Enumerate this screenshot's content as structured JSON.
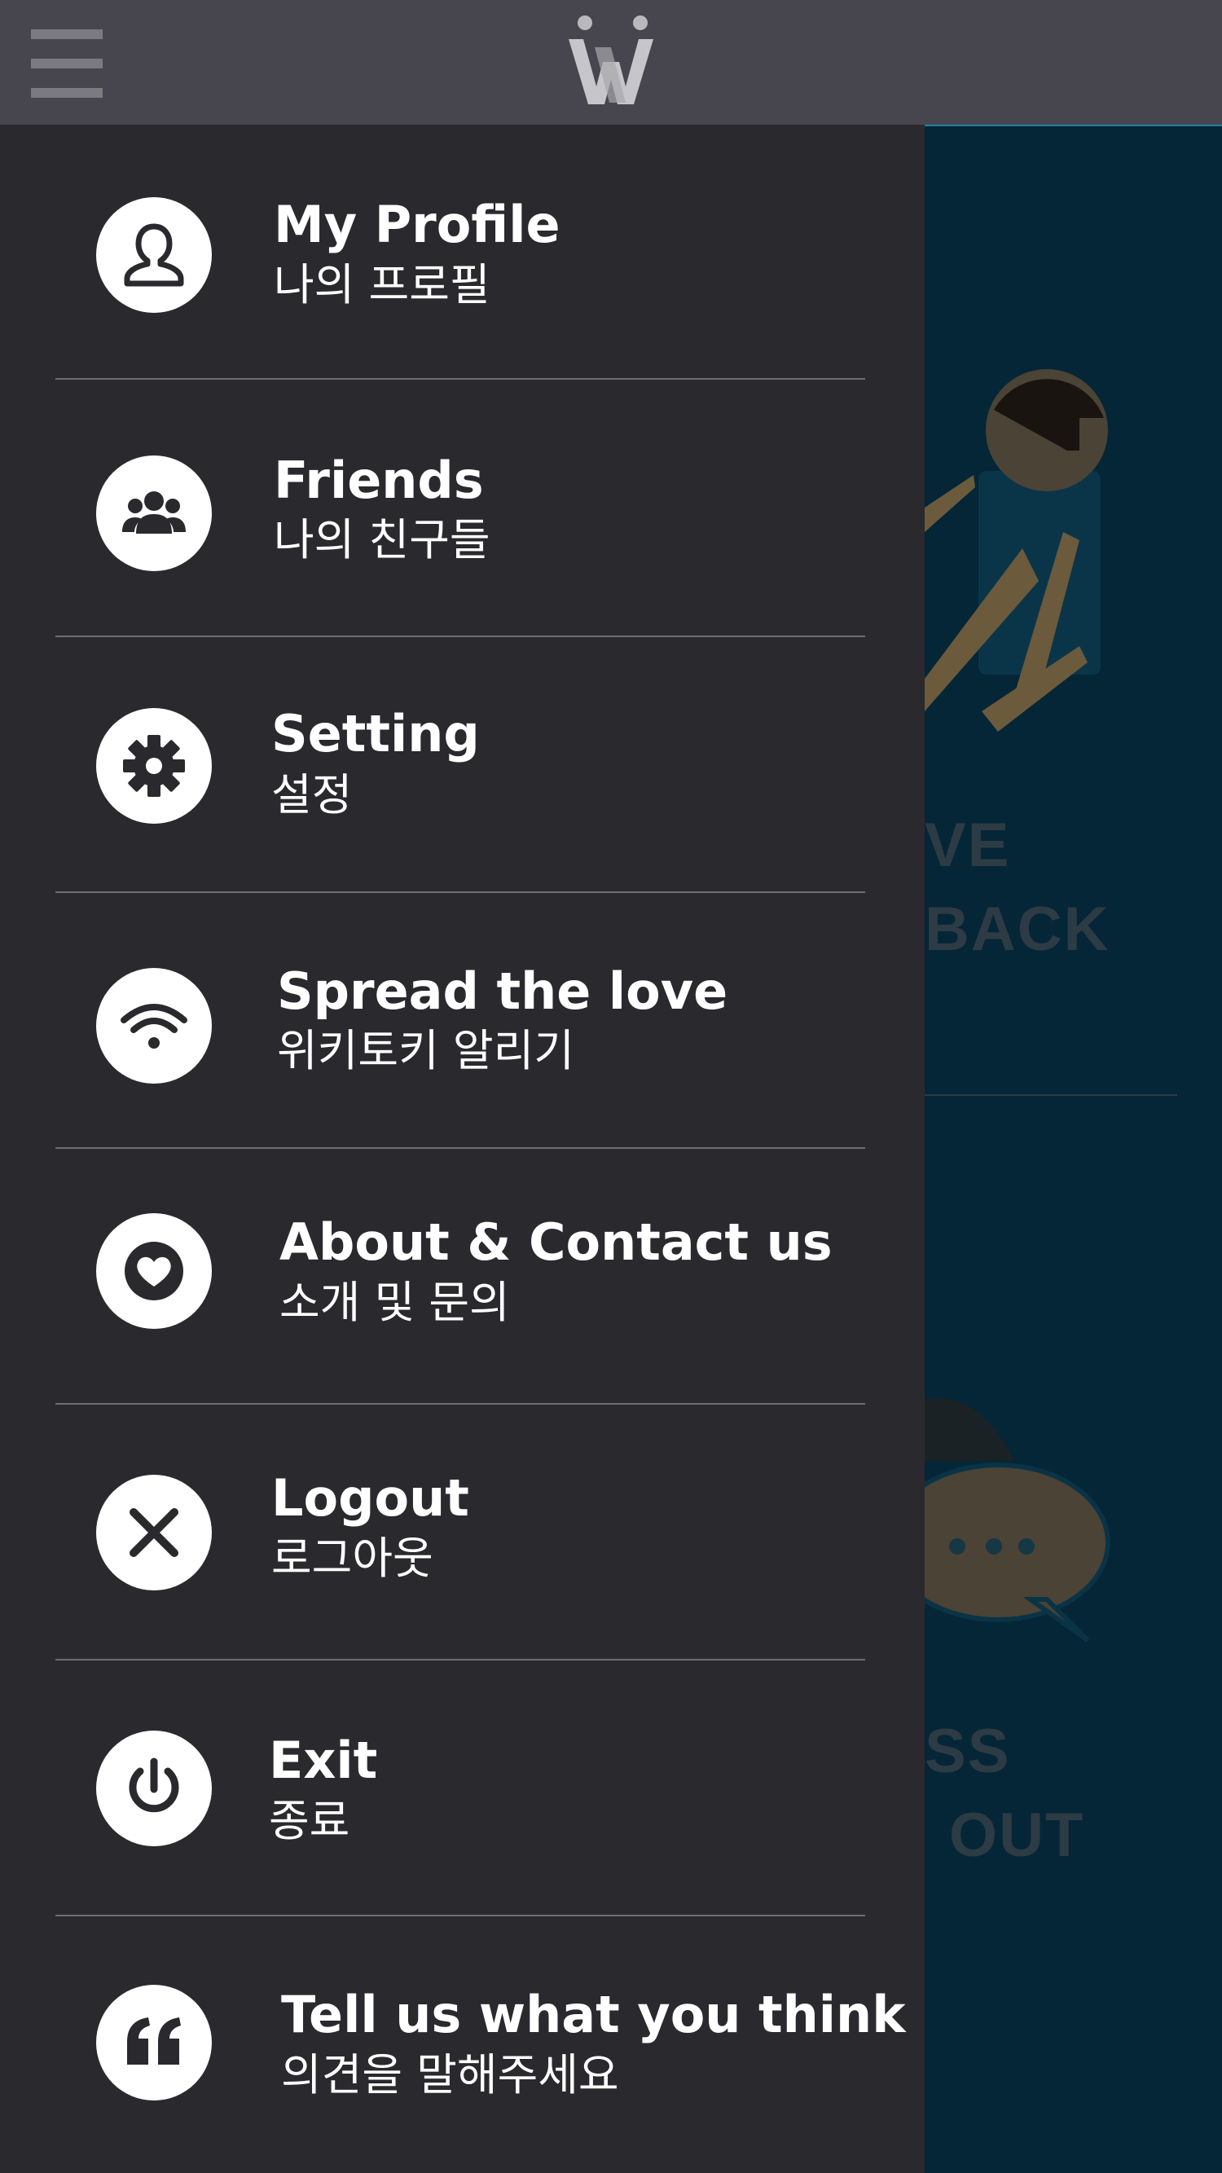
{
  "header": {
    "menu_icon": "hamburger-icon",
    "logo_icon": "wikitalki-logo"
  },
  "menu": {
    "items": [
      {
        "title": "My Profile",
        "subtitle": "나의 프로필",
        "icon": "profile-icon"
      },
      {
        "title": "Friends",
        "subtitle": "나의 친구들",
        "icon": "friends-icon"
      },
      {
        "title": "Setting",
        "subtitle": "설정",
        "icon": "gear-icon"
      },
      {
        "title": "Spread the love",
        "subtitle": "위키토키 알리기",
        "icon": "wifi-icon"
      },
      {
        "title": "About & Contact us",
        "subtitle": "소개 및 문의",
        "icon": "heart-icon"
      },
      {
        "title": "Logout",
        "subtitle": "로그아웃",
        "icon": "close-icon"
      },
      {
        "title": "Exit",
        "subtitle": "종료",
        "icon": "power-icon"
      },
      {
        "title": "Tell us what you think",
        "subtitle": "의견을 말해주세요",
        "icon": "quote-icon"
      }
    ]
  },
  "background": {
    "text1_line1": "VE",
    "text1_line2": "BACK",
    "text2_line1": "SS",
    "text2_line2": "OUT"
  },
  "colors": {
    "topbar": "#47464e",
    "drawer": "#2a2a2e",
    "background": "#052636",
    "icon_circle": "#ffffff"
  }
}
